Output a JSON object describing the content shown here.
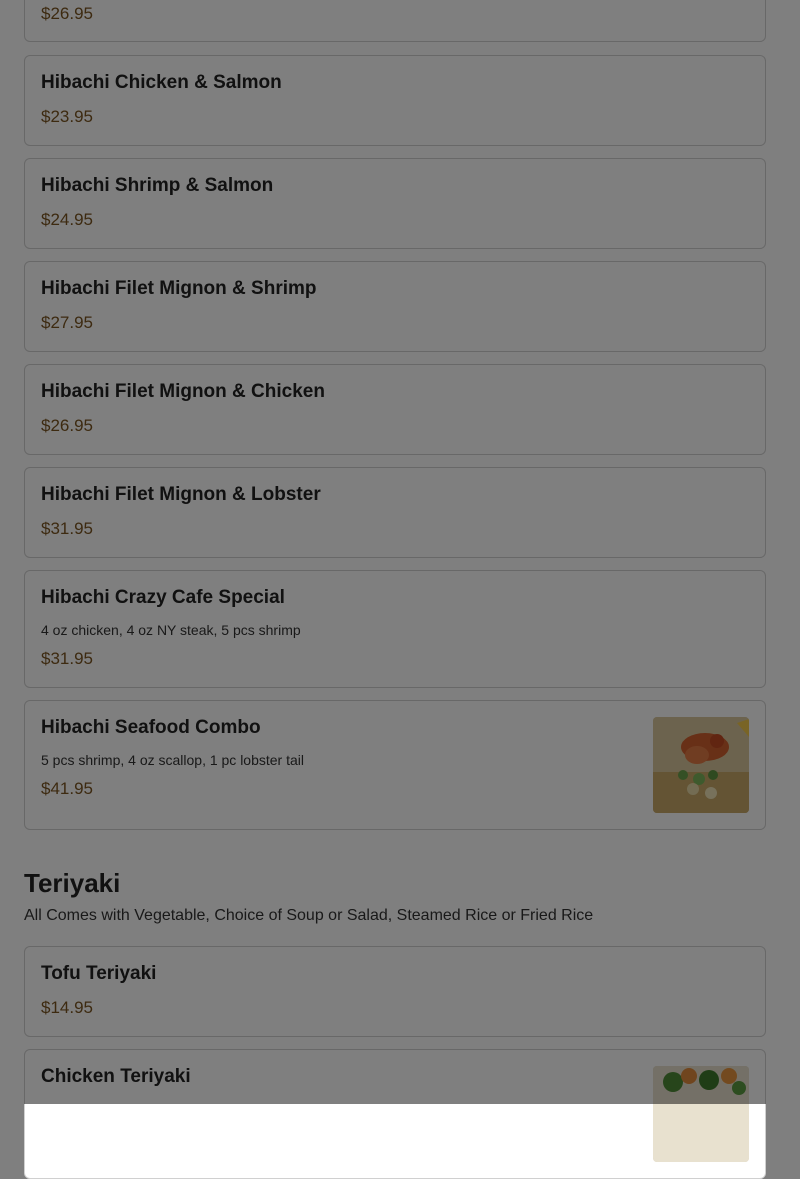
{
  "sections": {
    "hibachi": {
      "items": [
        {
          "name": "",
          "price": "$26.95"
        },
        {
          "name": "Hibachi Chicken & Salmon",
          "price": "$23.95"
        },
        {
          "name": "Hibachi Shrimp & Salmon",
          "price": "$24.95"
        },
        {
          "name": "Hibachi Filet Mignon & Shrimp",
          "price": "$27.95"
        },
        {
          "name": "Hibachi Filet Mignon & Chicken",
          "price": "$26.95"
        },
        {
          "name": "Hibachi Filet Mignon & Lobster",
          "price": "$31.95"
        },
        {
          "name": "Hibachi Crazy Cafe Special",
          "desc": "4 oz chicken, 4 oz NY steak, 5 pcs shrimp",
          "price": "$31.95"
        },
        {
          "name": "Hibachi Seafood Combo",
          "desc": "5 pcs shrimp, 4 oz scallop, 1 pc lobster tail",
          "price": "$41.95",
          "image": "seafood-combo-photo"
        }
      ]
    },
    "teriyaki": {
      "title": "Teriyaki",
      "subtitle": "All Comes with Vegetable, Choice of Soup or Salad, Steamed Rice or Fried Rice",
      "items": [
        {
          "name": "Tofu Teriyaki",
          "price": "$14.95"
        },
        {
          "name": "Chicken Teriyaki",
          "price": "",
          "image": "chicken-teriyaki-photo"
        }
      ]
    }
  },
  "overlay": {
    "color": "#000000",
    "opacity": 0.5
  }
}
